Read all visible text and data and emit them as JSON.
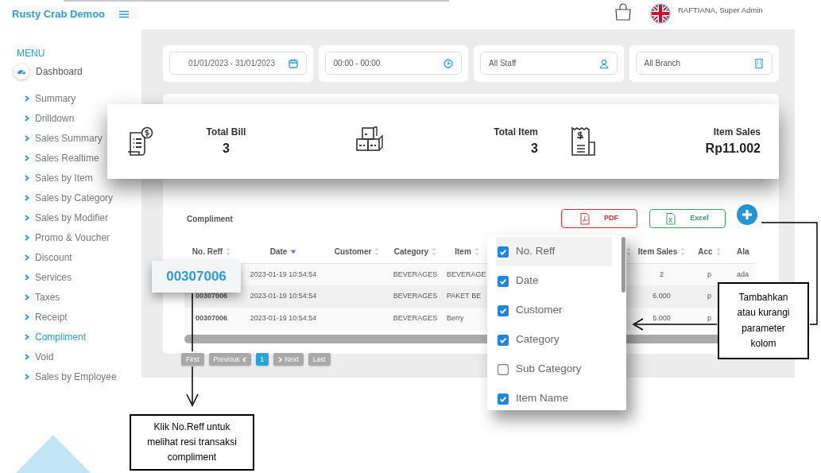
{
  "app": {
    "brand": "Rusty Crab Demoo"
  },
  "sidebar": {
    "heading": "MENU",
    "dashboard": "Dashboard",
    "items": [
      {
        "label": "Summary",
        "selected": false
      },
      {
        "label": "Drilldown",
        "selected": false
      },
      {
        "label": "Sales Summary",
        "selected": false
      },
      {
        "label": "Sales Realtime",
        "selected": false
      },
      {
        "label": "Sales by Item",
        "selected": false
      },
      {
        "label": "Sales by Category",
        "selected": false
      },
      {
        "label": "Sales by Modifier",
        "selected": false
      },
      {
        "label": "Promo & Voucher",
        "selected": false
      },
      {
        "label": "Discount",
        "selected": false
      },
      {
        "label": "Services",
        "selected": false
      },
      {
        "label": "Taxes",
        "selected": false
      },
      {
        "label": "Receipt",
        "selected": false
      },
      {
        "label": "Compliment",
        "selected": true
      },
      {
        "label": "Void",
        "selected": false
      },
      {
        "label": "Sales by Employee",
        "selected": false
      }
    ]
  },
  "topbar": {
    "user": "RAFTIANA, Super Admin"
  },
  "filters": [
    {
      "kind": "date",
      "value": "01/01/2023 - 31/01/2023"
    },
    {
      "kind": "time",
      "value": "00:00 - 00:00"
    },
    {
      "kind": "staff",
      "value": "All Staff"
    },
    {
      "kind": "branch",
      "value": "All Branch"
    }
  ],
  "summary": [
    {
      "kind": "bill",
      "label": "Total Bill",
      "value": "3"
    },
    {
      "kind": "item",
      "label": "Total Item",
      "value": "3"
    },
    {
      "kind": "sales",
      "label": "Item Sales",
      "value": "Rp11.002"
    }
  ],
  "report": {
    "title": "Compliment",
    "buttons": [
      {
        "kind": "pdf",
        "label": "PDF"
      },
      {
        "kind": "excel",
        "label": "Excel"
      }
    ],
    "table": {
      "columns": [
        {
          "label": "No. Reff",
          "sorted": false
        },
        {
          "label": "Date",
          "sorted": true
        },
        {
          "label": "Customer",
          "sorted": false
        },
        {
          "label": "Category",
          "sorted": false
        },
        {
          "label": "Item",
          "sorted": false
        },
        {
          "sorted": false
        },
        {
          "label": "Item Sales",
          "sorted": false
        },
        {
          "label": "Acc",
          "sorted": false
        },
        {
          "label": "Ala"
        }
      ],
      "rows": [
        [
          null,
          "2023-01-19 10:54:54",
          null,
          "BEVERAGES",
          "BEVERAGE",
          null,
          "2",
          "p",
          "ada"
        ],
        [
          "00307006",
          "2023-01-19 10:54:54",
          null,
          "BEVERAGES",
          "PAKET BE",
          null,
          "6.000",
          "p",
          null
        ],
        [
          "00307006",
          "2023-01-19 10:54:54",
          null,
          "BEVERAGES",
          "Berry",
          null,
          "5.000",
          "p",
          null
        ]
      ]
    },
    "pagination": [
      {
        "kind": "first",
        "label": "First",
        "selected": false
      },
      {
        "kind": "prev",
        "label": "Previous",
        "selected": false
      },
      {
        "kind": "page",
        "label": "1",
        "selected": true
      },
      {
        "kind": "next",
        "label": "Next",
        "selected": false
      },
      {
        "kind": "last",
        "label": "Last",
        "selected": false
      }
    ]
  },
  "column_menu": {
    "items": [
      {
        "label": "No. Reff",
        "checked": true,
        "selected": true
      },
      {
        "label": "Date",
        "checked": true,
        "selected": false
      },
      {
        "label": "Customer",
        "checked": true,
        "selected": false
      },
      {
        "label": "Category",
        "checked": true,
        "selected": false
      },
      {
        "label": "Sub Category",
        "checked": false,
        "selected": false
      },
      {
        "label": "Item Name",
        "checked": true,
        "selected": false
      }
    ]
  },
  "magnified_reference": "00307006",
  "notes": [
    {
      "text": "Klik  No.Reff untuk\nmelihat  resi transaksi\ncompliment"
    },
    {
      "text": "Tambahkan\natau kurangi\nparameter\nkolom"
    }
  ]
}
